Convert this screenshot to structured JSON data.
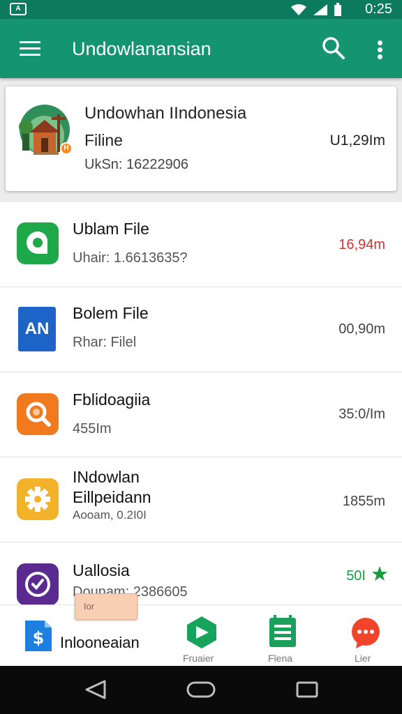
{
  "status_bar": {
    "time": "0:25",
    "notification_badge": "A"
  },
  "app_bar": {
    "title": "Undowlanansian"
  },
  "featured": {
    "title": "Undowhan IIndonesia",
    "subtitle": "Filine",
    "meta": "UkSn: 16222906",
    "size": "U1,29Im",
    "badge": "H"
  },
  "files": [
    {
      "name": "Ublam File",
      "sub": "Uhair: 1.6613635?",
      "size": "16,94m",
      "size_color": "#d32f2f",
      "icon": "chat-bubble-icon",
      "icon_color": "#1fa84a"
    },
    {
      "name": "Bolem File",
      "sub": "Rhar: Filel",
      "size": "00,90m",
      "size_color": "#444444",
      "icon": "document-icon",
      "icon_color": "#1e63c8",
      "icon_text": "AN"
    },
    {
      "name": "Fblidoagiia",
      "sub": "455Im",
      "size": "35:0/Im",
      "size_color": "#444444",
      "icon": "magnifier-icon",
      "icon_color": "#f07a1d"
    },
    {
      "name": "INdowlan",
      "name2": "Eillpeidann",
      "sub": "Aooam, 0.2I0I",
      "size": "1855m",
      "size_color": "#444444",
      "icon": "gear-icon",
      "icon_color": "#f2b22a"
    },
    {
      "name": "Uallosia",
      "sub": "Dounam: 2386605",
      "size": "50I",
      "size_color": "#1a9b3f",
      "icon": "clock-icon",
      "icon_color": "#5b2a91"
    }
  ],
  "toast": {
    "text": "Ior"
  },
  "bottom_nav": {
    "primary_label": "Inlooneaian",
    "items": [
      {
        "label": "Fruaier",
        "icon": "play-shape-icon",
        "color": "#16a35b"
      },
      {
        "label": "Flena",
        "icon": "list-doc-icon",
        "color": "#1aa05a"
      },
      {
        "label": "Lier",
        "icon": "chat-icon",
        "color": "#f0452a"
      }
    ]
  }
}
